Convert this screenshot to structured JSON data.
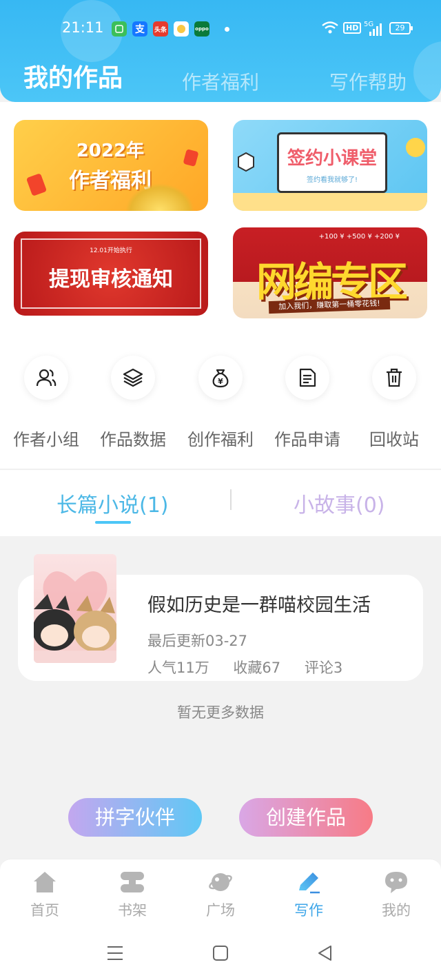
{
  "status_bar": {
    "time": "21:11",
    "apps": [
      {
        "name": "wechat-like-app",
        "color": "#3cbf5a",
        "label": ""
      },
      {
        "name": "alipay-app",
        "color": "#1677ff",
        "label": "支"
      },
      {
        "name": "toutiao-app",
        "color": "#e63b2e",
        "label": "头条"
      },
      {
        "name": "app-four",
        "color": "#f7c843",
        "label": ""
      },
      {
        "name": "oppo-app",
        "color": "#0a7a3a",
        "label": "oppo"
      }
    ],
    "hd": "HD",
    "network": "5G",
    "battery": "29"
  },
  "top_tabs": {
    "tab1": "我的作品",
    "tab2": "作者福利",
    "tab3": "写作帮助"
  },
  "banners": {
    "b1_line1": "2022年",
    "b1_line2": "作者福利",
    "b2_title": "签约小课堂",
    "b2_sub": "签约看我就够了!",
    "b3_small": "12.01开始执行",
    "b3_title": "提现审核通知",
    "b4_title": "网编专区",
    "b4_slogan": "加入我们，赚取第一桶零花钱!",
    "b4_small": "+100 ¥  +500 ¥  +200 ¥"
  },
  "shortcuts": [
    {
      "label": "作者小组",
      "icon": "group-icon"
    },
    {
      "label": "作品数据",
      "icon": "layers-icon"
    },
    {
      "label": "创作福利",
      "icon": "money-bag-icon"
    },
    {
      "label": "作品申请",
      "icon": "document-icon"
    },
    {
      "label": "回收站",
      "icon": "trash-icon"
    }
  ],
  "segments": {
    "long_novel": "长篇小说(1)",
    "short_story": "小故事(0)"
  },
  "book": {
    "title": "假如历史是一群喵校园生活",
    "updated": "最后更新03-27",
    "popularity": "人气11万",
    "favorites": "收藏67",
    "comments": "评论3"
  },
  "no_more": "暂无更多数据",
  "buttons": {
    "partner": "拼字伙伴",
    "create": "创建作品"
  },
  "bottom_nav": [
    {
      "label": "首页",
      "icon": "home-icon"
    },
    {
      "label": "书架",
      "icon": "bookshelf-icon"
    },
    {
      "label": "广场",
      "icon": "planet-icon"
    },
    {
      "label": "写作",
      "icon": "pen-icon",
      "active": true
    },
    {
      "label": "我的",
      "icon": "chat-bubble-icon"
    }
  ],
  "colors": {
    "header": "#37b8f3",
    "active_tab": "#4cb8e6",
    "inactive_tab": "#c8b3e8",
    "nav_active": "#3ea6e8"
  }
}
